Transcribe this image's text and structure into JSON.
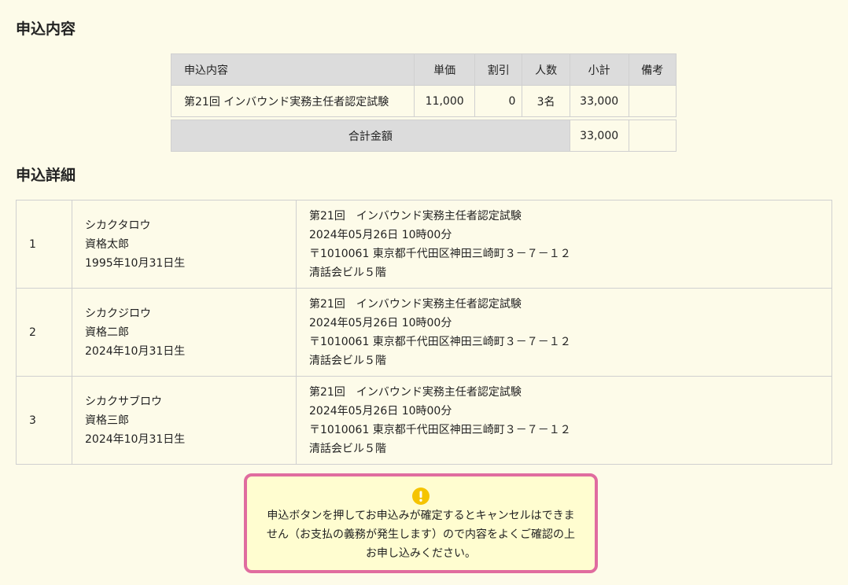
{
  "sections": {
    "order_heading": "申込内容",
    "detail_heading": "申込詳細"
  },
  "order_table": {
    "headers": [
      "申込内容",
      "単価",
      "割引",
      "人数",
      "小計",
      "備考"
    ],
    "row": {
      "title": "第21回 インバウンド実務主任者認定試験",
      "price": "11,000",
      "discount": "0",
      "people": "3名",
      "subtotal": "33,000",
      "note": ""
    },
    "total_label": "合計金額",
    "total_value": "33,000"
  },
  "applicants": [
    {
      "no": "1",
      "kana": "シカクタロウ",
      "name": "資格太郎",
      "birth": "1995年10月31日生",
      "exam": "第21回　インバウンド実務主任者認定試験",
      "datetime": "2024年05月26日 10時00分",
      "address": "〒1010061 東京都千代田区神田三崎町３－７－１２",
      "building": "清話会ビル５階"
    },
    {
      "no": "2",
      "kana": "シカクジロウ",
      "name": "資格二郎",
      "birth": "2024年10月31日生",
      "exam": "第21回　インバウンド実務主任者認定試験",
      "datetime": "2024年05月26日 10時00分",
      "address": "〒1010061 東京都千代田区神田三崎町３－７－１２",
      "building": "清話会ビル５階"
    },
    {
      "no": "3",
      "kana": "シカクサブロウ",
      "name": "資格三郎",
      "birth": "2024年10月31日生",
      "exam": "第21回　インバウンド実務主任者認定試験",
      "datetime": "2024年05月26日 10時00分",
      "address": "〒1010061 東京都千代田区神田三崎町３－７－１２",
      "building": "清話会ビル５階"
    }
  ],
  "notice": {
    "icon": "warning-icon",
    "line1": "申込ボタンを押してお申込みが確定するとキャンセルはできま",
    "line2": "せん（お支払の義務が発生します）ので内容をよくご確認の上",
    "line3": "お申し込みください。",
    "border_color": "#e06c9f",
    "icon_color": "#f5c400"
  }
}
